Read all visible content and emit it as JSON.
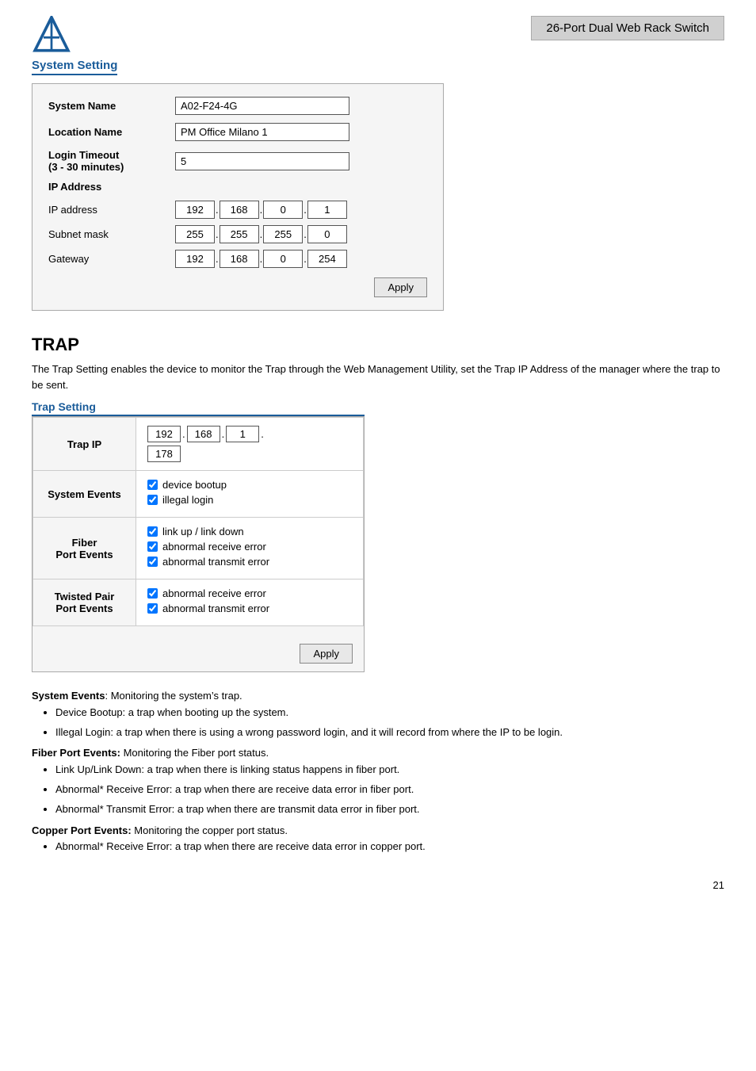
{
  "header": {
    "product_title": "26-Port Dual Web Rack Switch",
    "system_setting_label": "System Setting"
  },
  "system_setting": {
    "system_name_label": "System Name",
    "system_name_value": "A02-F24-4G",
    "location_name_label": "Location Name",
    "location_name_value": "PM Office Milano 1",
    "login_timeout_label": "Login Timeout",
    "login_timeout_sublabel": "(3 - 30 minutes)",
    "login_timeout_value": "5",
    "ip_address_section": "IP Address",
    "ip_address_label": "IP address",
    "ip_address": [
      "192",
      "168",
      "0",
      "1"
    ],
    "subnet_mask_label": "Subnet mask",
    "subnet_mask": [
      "255",
      "255",
      "255",
      "0"
    ],
    "gateway_label": "Gateway",
    "gateway": [
      "192",
      "168",
      "0",
      "254"
    ],
    "apply_label": "Apply"
  },
  "trap": {
    "heading": "TRAP",
    "description": "The Trap Setting enables the device to monitor the Trap through the Web Management Utility, set the Trap IP Address of the manager where the trap to be sent.",
    "trap_setting_label": "Trap Setting",
    "trap_ip_label": "Trap IP",
    "trap_ip": [
      "192",
      "168",
      "1"
    ],
    "trap_ip_last": "178",
    "system_events_label": "System Events",
    "system_events": [
      {
        "label": "device bootup",
        "checked": true
      },
      {
        "label": "illegal login",
        "checked": true
      }
    ],
    "fiber_port_events_label": "Fiber",
    "fiber_port_events_sublabel": "Port Events",
    "fiber_port_events": [
      {
        "label": "link up / link down",
        "checked": true
      },
      {
        "label": "abnormal receive error",
        "checked": true
      },
      {
        "label": "abnormal transmit error",
        "checked": true
      }
    ],
    "twisted_pair_label": "Twisted Pair",
    "twisted_pair_sublabel": "Port Events",
    "twisted_pair_events": [
      {
        "label": "abnormal receive error",
        "checked": true
      },
      {
        "label": "abnormal transmit error",
        "checked": true
      }
    ],
    "apply_label": "Apply"
  },
  "descriptions": {
    "system_events_title": "System Events",
    "system_events_desc": ": Monitoring the system’s trap.",
    "system_events_bullets": [
      "Device Bootup: a trap when booting up the system.",
      "Illegal Login: a trap when there is using a wrong password login, and it will record from where the IP to be login."
    ],
    "fiber_title": "Fiber Port Events:",
    "fiber_desc": " Monitoring the Fiber port status.",
    "fiber_bullets": [
      "Link Up/Link Down: a trap when there is linking status happens in fiber port.",
      "Abnormal* Receive Error: a trap when there are receive data error in fiber port.",
      "Abnormal* Transmit Error: a trap when there are transmit data error in fiber port."
    ],
    "copper_title": "Copper Port Events:",
    "copper_desc": " Monitoring the copper port status.",
    "copper_bullets": [
      "Abnormal* Receive Error: a trap when there are receive data error in copper port."
    ]
  },
  "page_number": "21"
}
